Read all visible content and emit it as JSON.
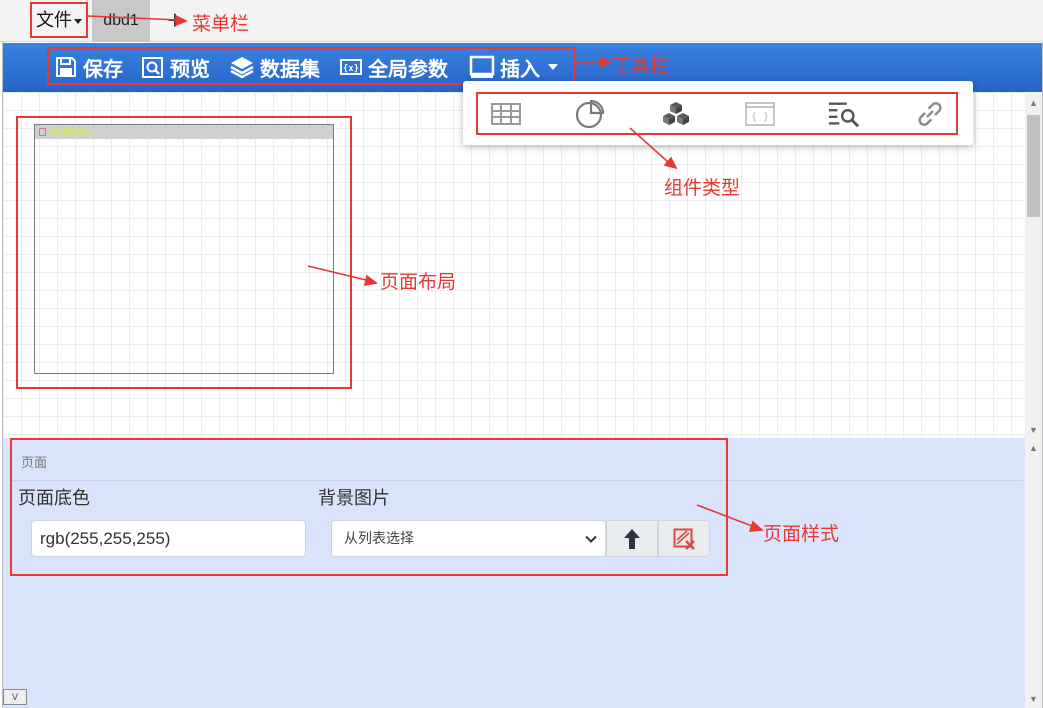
{
  "menubar": {
    "file_label": "文件",
    "tabs": [
      {
        "label": "dbd1"
      }
    ],
    "add_tab_label": "+"
  },
  "toolbar": {
    "items": [
      {
        "label": "保存",
        "icon": "save-icon"
      },
      {
        "label": "预览",
        "icon": "preview-icon"
      },
      {
        "label": "数据集",
        "icon": "layers-icon"
      },
      {
        "label": "全局参数",
        "icon": "params-icon"
      },
      {
        "label": "插入",
        "icon": "insert-icon"
      }
    ]
  },
  "insert_menu": {
    "components": [
      {
        "icon": "table-icon"
      },
      {
        "icon": "pie-chart-icon"
      },
      {
        "icon": "cubes-icon"
      },
      {
        "icon": "code-window-icon"
      },
      {
        "icon": "search-list-icon"
      },
      {
        "icon": "link-icon"
      }
    ]
  },
  "canvas": {
    "widget_title": "网格组件0"
  },
  "style_panel": {
    "title": "页面",
    "bg_color_label": "页面底色",
    "bg_color_value": "rgb(255,255,255)",
    "bg_image_label": "背景图片",
    "bg_image_selected": "从列表选择"
  },
  "collapse_label": "V",
  "annotations": {
    "menubar": "菜单栏",
    "toolbar": "工具栏",
    "component_types": "组件类型",
    "page_layout": "页面布局",
    "page_style": "页面样式"
  },
  "colors": {
    "toolbar_bg": "#2f74d8",
    "annotation_red": "#e53935",
    "panel_bg": "#d9e3fc"
  }
}
